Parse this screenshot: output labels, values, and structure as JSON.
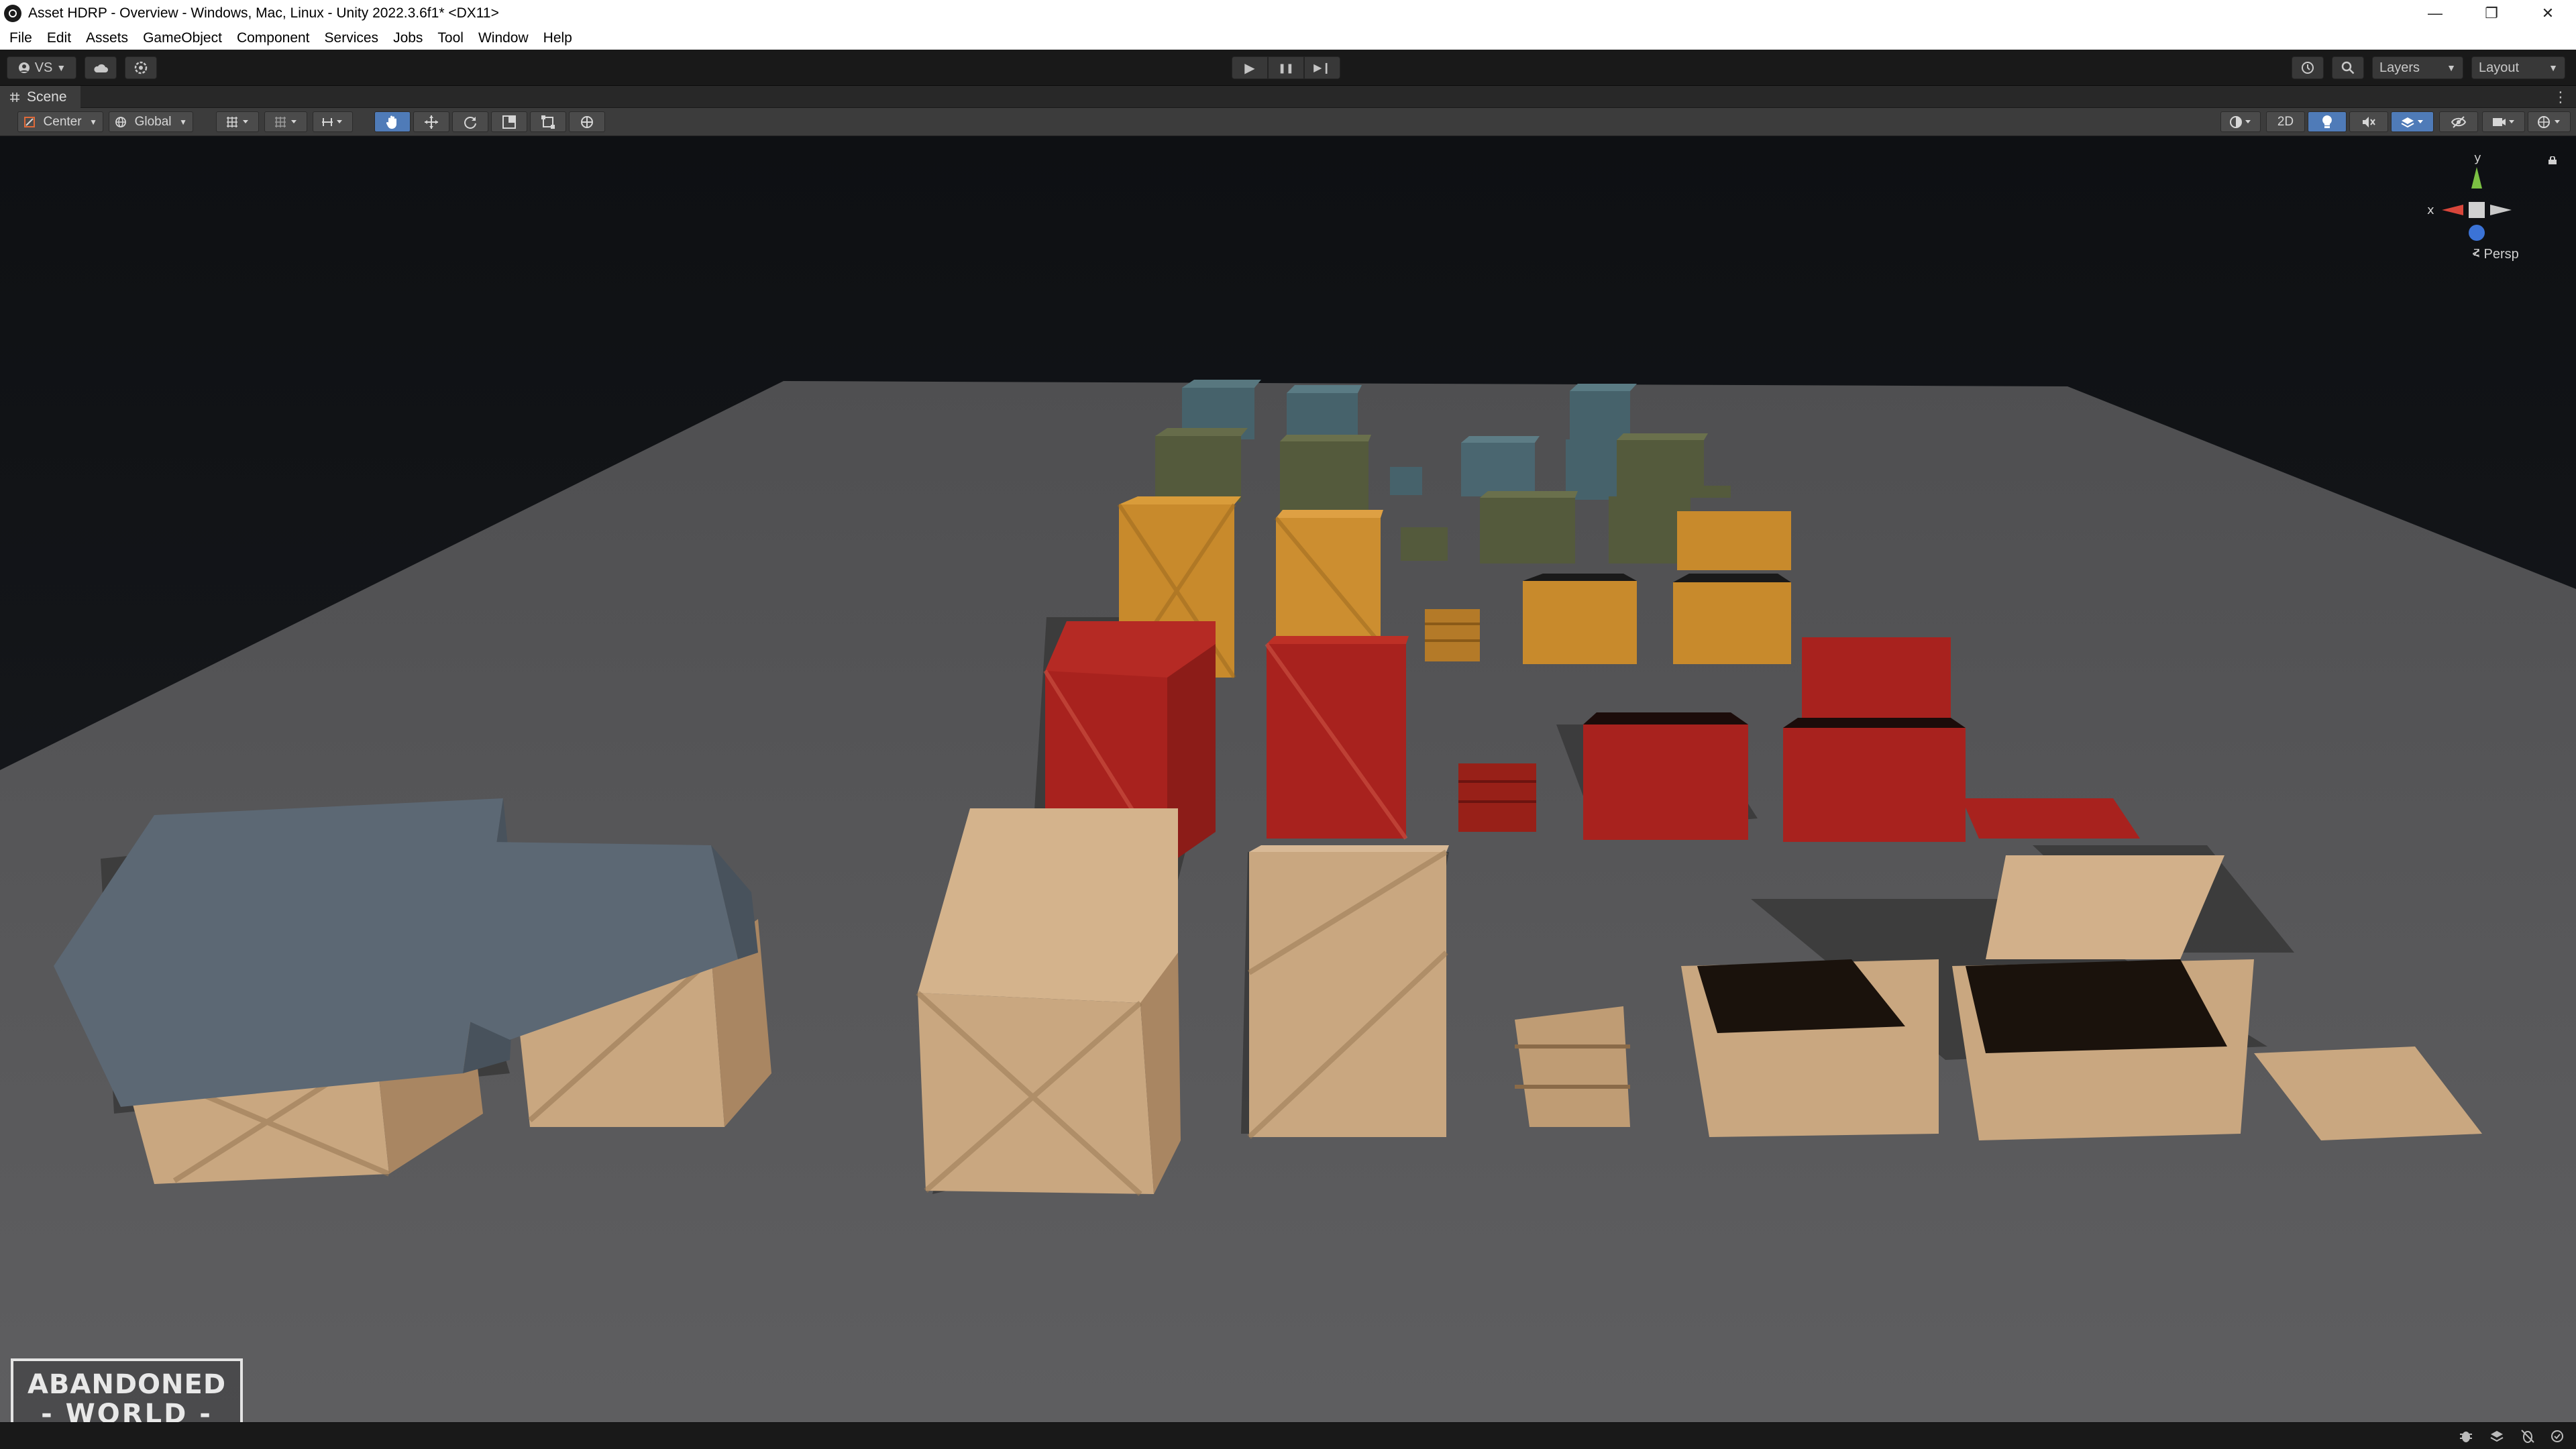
{
  "window": {
    "title": "Asset HDRP - Overview - Windows, Mac, Linux - Unity 2022.3.6f1* <DX11>",
    "controls": {
      "minimize": "—",
      "restore": "❐",
      "close": "✕"
    }
  },
  "menu": [
    "File",
    "Edit",
    "Assets",
    "GameObject",
    "Component",
    "Services",
    "Jobs",
    "Tool",
    "Window",
    "Help"
  ],
  "toolbar": {
    "account_label": "VS",
    "play": "▶",
    "pause": "❚❚",
    "step": "▶❙",
    "layers_label": "Layers",
    "layout_label": "Layout"
  },
  "scene_tab": {
    "label": "Scene"
  },
  "scene_toolbar": {
    "pivot_label": "Center",
    "space_label": "Global",
    "mode_2d_label": "2D"
  },
  "gizmo": {
    "y_label": "y",
    "x_label": "x",
    "z_label": "z",
    "projection_label": "< Persp"
  },
  "logo": {
    "line1": "ABANDONED",
    "line2": "- WORLD -"
  },
  "colors": {
    "crate_blue": "#46626b",
    "crate_olive": "#545a3c",
    "crate_orange": "#c88a2c",
    "crate_red": "#a8221e",
    "crate_wood": "#c9a780",
    "tarp": "#5c6874",
    "ground": "#585858",
    "sky": "#121417",
    "accent_blue": "#4f7bb8"
  }
}
